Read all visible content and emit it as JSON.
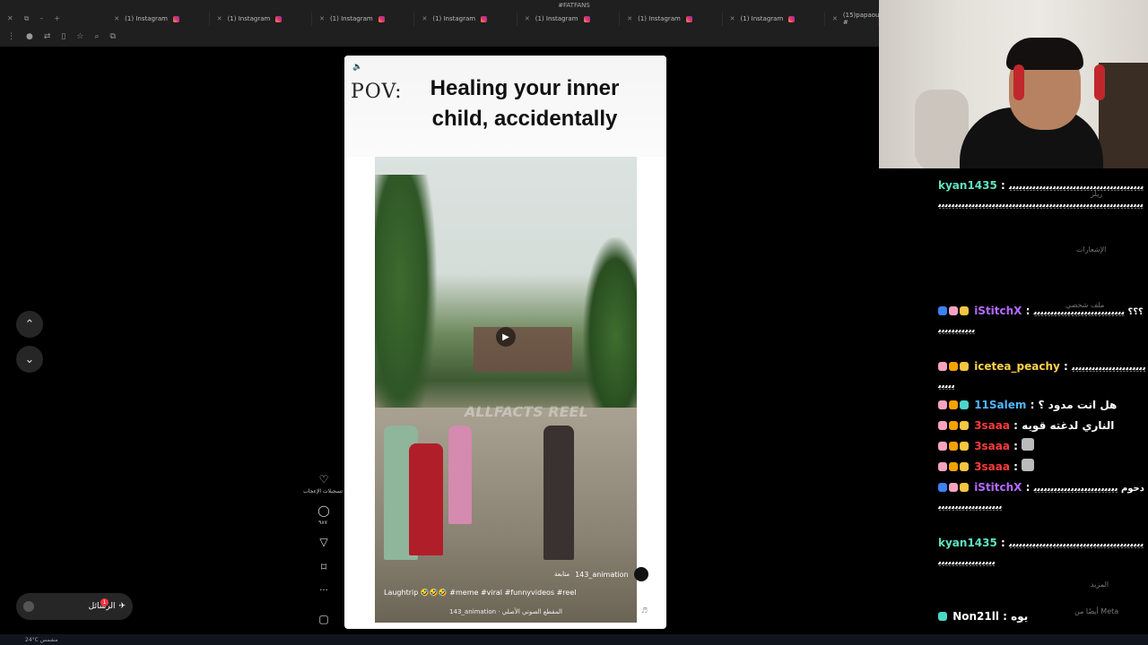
{
  "browser": {
    "window_title": "#FATFANS",
    "tabs": [
      {
        "label": "(1) Instagram"
      },
      {
        "label": "(1) Instagram"
      },
      {
        "label": "(1) Instagram"
      },
      {
        "label": "(1) Instagram"
      },
      {
        "label": "(1) Instagram"
      },
      {
        "label": "(1) Instagram"
      },
      {
        "label": "(1) Instagram"
      },
      {
        "label": "(15)papaoutai?#"
      }
    ]
  },
  "reel": {
    "pov": "POV:",
    "headline": "Healing your inner child, accidentally",
    "watermark": "ALLFACTS REEL",
    "author": "143_animation",
    "follow_label": "متابعة",
    "caption": "Laughtrip 🤣🤣🤣 #meme #viral #funnyvideos #reel",
    "audio": "143_animation · المقطع الصوتي الأصلي"
  },
  "actions": {
    "likes_label": "تسجيلات الإعجاب",
    "comments_count": "٩٨٧"
  },
  "messages": {
    "label": "الرسائل",
    "badge": "1"
  },
  "chat": {
    "ghost": {
      "reels": "ريلز",
      "notifications": "الإشعارات",
      "profile": "ملف شخصي",
      "more": "المزيد",
      "also_meta": "أيضًا من Meta"
    },
    "messages": [
      {
        "user": "kyan1435",
        "color": "#5fe3c0",
        "body": "ﯾﯾﯾﯾﯾﯾﯾﯾﯾﯾﯾﯾﯾﯾﯾﯾﯾﯾﯾﯾﯾﯾﯾﯾﯾﯾﯾﯾﯾﯾﯾﯾﯾﯾﯾﯾﯾﯾﯾﯾﯾﯾﯾﯾﯾﯾﯾﯾﯾﯾﯾﯾﯾﯾﯾﯾﯾﯾﯾﯾﯾﯾﯾﯾﯾﯾﯾﯾﯾﯾﯾﯾﯾﯾﯾﯾﯾﯾﯾﯾﯾﯾﯾﯾﯾﯾﯾﯾﯾﯾﯾﯾﯾﯾﯾﯾﯾﯾﯾﯾﯾ"
      },
      {
        "user": "iStitchX",
        "color": "#b46bff",
        "body": "؟؟؟ ﯾﯾﯾﯾﯾﯾﯾﯾﯾﯾﯾﯾﯾﯾﯾﯾﯾﯾﯾﯾﯾﯾﯾﯾﯾﯾﯾﯾﯾﯾﯾﯾﯾﯾﯾﯾﯾﯾ"
      },
      {
        "user": "icetea_peachy",
        "color": "#ffd24a",
        "body": "ﯾﯾﯾﯾﯾﯾﯾﯾﯾﯾﯾﯾﯾﯾﯾﯾﯾﯾﯾﯾﯾﯾﯾﯾﯾﯾﯾ"
      },
      {
        "user": "11Salem",
        "color": "#4fb7ff",
        "body": "هل انت مدود ؟"
      },
      {
        "user": "3saaa",
        "color": "#ff3b3b",
        "body": "الناري لدغته قويه"
      },
      {
        "user": "3saaa",
        "color": "#ff3b3b",
        "body": ""
      },
      {
        "user": "3saaa",
        "color": "#ff3b3b",
        "body": ""
      },
      {
        "user": "iStitchX",
        "color": "#b46bff",
        "body": "دحوم ﯾﯾﯾﯾﯾﯾﯾﯾﯾﯾﯾﯾﯾﯾﯾﯾﯾﯾﯾﯾﯾﯾﯾﯾﯾﯾﯾﯾﯾﯾﯾﯾﯾﯾﯾﯾﯾﯾﯾﯾﯾﯾﯾﯾ"
      },
      {
        "user": "kyan1435",
        "color": "#5fe3c0",
        "body": "ﯾﯾﯾﯾﯾﯾﯾﯾﯾﯾﯾﯾﯾﯾﯾﯾﯾﯾﯾﯾﯾﯾﯾﯾﯾﯾﯾﯾﯾﯾﯾﯾﯾﯾﯾﯾﯾﯾﯾﯾﯾﯾﯾﯾﯾﯾﯾﯾﯾﯾﯾﯾﯾﯾﯾﯾﯾ"
      },
      {
        "user": "Non21ll",
        "color": "#ffffff",
        "body": "يوه"
      }
    ]
  },
  "taskbar": {
    "weather": "24°C مشمس"
  }
}
